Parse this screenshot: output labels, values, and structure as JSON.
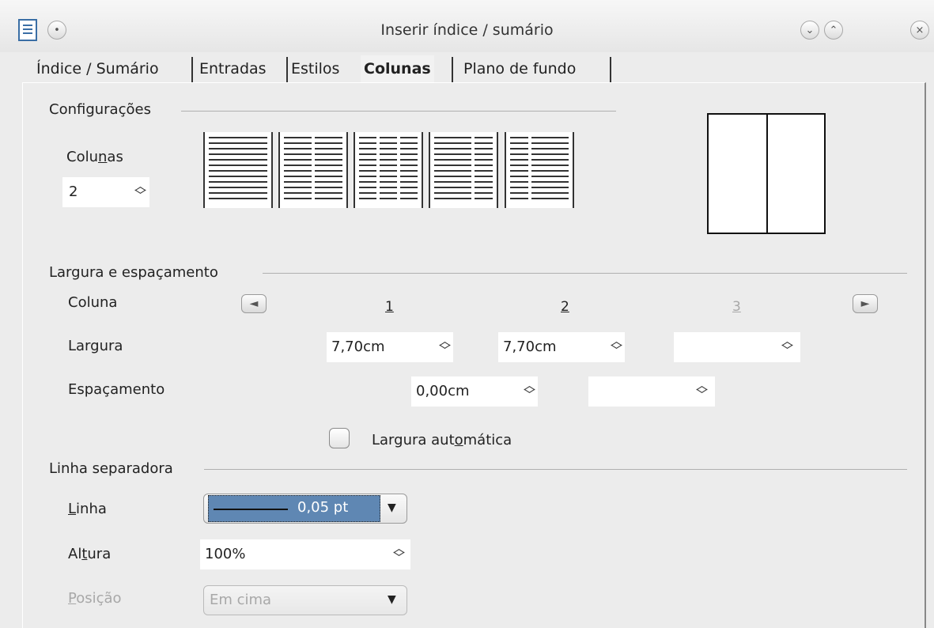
{
  "window": {
    "title": "Inserir índice / sumário",
    "icons": [
      "document-icon",
      "menu-circle-icon",
      "minimize-icon",
      "maximize-icon",
      "close-icon"
    ]
  },
  "tabs": [
    {
      "label": "Índice / Sumário",
      "selected": false
    },
    {
      "label": "Entradas",
      "selected": false
    },
    {
      "label": "Estilos",
      "selected": false
    },
    {
      "label": "Colunas",
      "selected": true
    },
    {
      "label": "Plano de fundo",
      "selected": false
    }
  ],
  "settings": {
    "group_title": "Configurações",
    "columns_label_pre": "Colu",
    "columns_label_u": "n",
    "columns_label_post": "as",
    "columns_value": "2"
  },
  "width_spacing": {
    "group_title": "Largura e espaçamento",
    "column_label": "Coluna",
    "col_numbers": [
      "1",
      "2",
      "3"
    ],
    "width_label": "Largura",
    "width_values": [
      "7,70cm",
      "7,70cm",
      ""
    ],
    "spacing_label": "Espaçamento",
    "spacing_values": [
      "0,00cm",
      ""
    ],
    "autowidth_label_pre": "Largura aut",
    "autowidth_label_u": "o",
    "autowidth_label_post": "mática",
    "autowidth_checked": false
  },
  "separator": {
    "group_title": "Linha separadora",
    "line_label_u": "L",
    "line_label_post": "inha",
    "line_value": "0,05 pt",
    "height_label_pre": "Al",
    "height_label_u": "t",
    "height_label_post": "ura",
    "height_value": "100%",
    "position_label_u": "P",
    "position_label_post": "osição",
    "position_value": "Em cima"
  },
  "colors": {
    "selection": "#5f87b3",
    "disabled_text": "#a8a8a8"
  }
}
